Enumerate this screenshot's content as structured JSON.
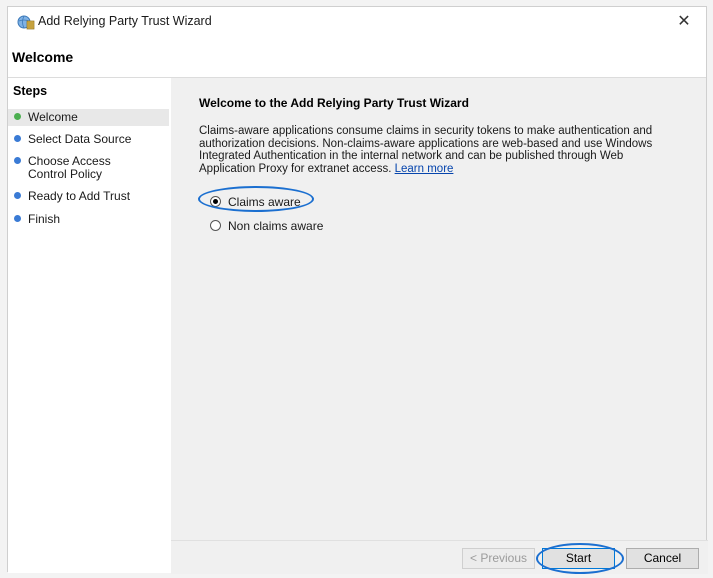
{
  "window": {
    "title": "Add Relying Party Trust Wizard"
  },
  "header": {
    "title": "Welcome"
  },
  "steps": {
    "title": "Steps",
    "items": [
      {
        "label": "Welcome",
        "status": "current",
        "color": "#4caf50"
      },
      {
        "label": "Select Data Source",
        "status": "pending",
        "color": "#3a7bd5"
      },
      {
        "label": "Choose Access Control Policy",
        "status": "pending",
        "color": "#3a7bd5"
      },
      {
        "label": "Ready to Add Trust",
        "status": "pending",
        "color": "#3a7bd5"
      },
      {
        "label": "Finish",
        "status": "pending",
        "color": "#3a7bd5"
      }
    ]
  },
  "main": {
    "heading": "Welcome to the Add Relying Party Trust Wizard",
    "description": "Claims-aware applications consume claims in security tokens to make authentication and authorization decisions. Non-claims-aware applications are web-based and use Windows Integrated Authentication in the internal network and can be published through Web Application Proxy for extranet access.",
    "learn_more": "Learn more",
    "options": [
      {
        "label": "Claims aware",
        "checked": true
      },
      {
        "label": "Non claims aware",
        "checked": false
      }
    ]
  },
  "buttons": {
    "previous": "< Previous",
    "start": "Start",
    "cancel": "Cancel"
  },
  "colors": {
    "annotation": "#1b6fd0",
    "link": "#0645ad"
  },
  "icons": {
    "app": "wizard-globe-icon",
    "close": "close-icon"
  }
}
